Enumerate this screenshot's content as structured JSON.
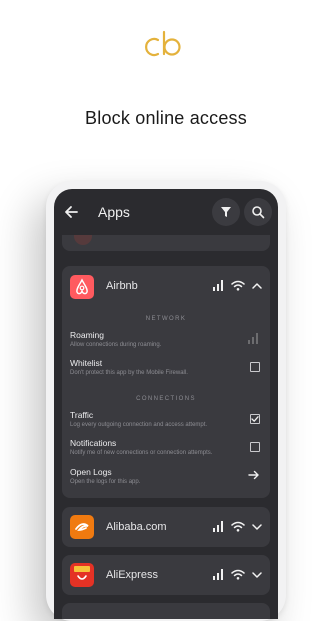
{
  "headline": "Block online access",
  "appbar": {
    "title": "Apps"
  },
  "expanded_app": {
    "name": "Airbnb",
    "network_section": "NETWORK",
    "connections_section": "CONNECTIONS",
    "options": [
      {
        "title": "Roaming",
        "desc": "Allow connections during roaming.",
        "control": "signal",
        "checked": false
      },
      {
        "title": "Whitelist",
        "desc": "Don't protect this app by the Mobile Firewall.",
        "control": "checkbox",
        "checked": false
      },
      {
        "title": "Traffic",
        "desc": "Log every outgoing connection and access attempt.",
        "control": "checkbox",
        "checked": true
      },
      {
        "title": "Notifications",
        "desc": "Notify me of new connections or connection attempts.",
        "control": "checkbox",
        "checked": false
      },
      {
        "title": "Open Logs",
        "desc": "Open the logs for this app.",
        "control": "arrow",
        "checked": false
      }
    ]
  },
  "apps": [
    {
      "name": "Alibaba.com",
      "icon_color": "#f07a10",
      "icon": "alibaba-logo-icon"
    },
    {
      "name": "AliExpress",
      "icon_color": "#e43225",
      "icon": "aliexpress-logo-icon"
    }
  ],
  "colors": {
    "accent_logo": "#e4b23c",
    "airbnb": "#ff5a5f",
    "screen_bg": "#2b2b2f",
    "card_bg": "#3a3a3f"
  }
}
